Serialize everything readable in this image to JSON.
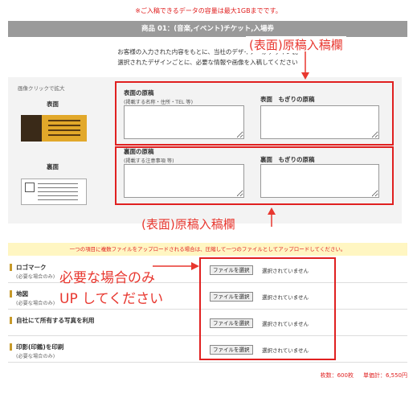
{
  "notice": "※ご入稿できるデータの容量は最大1GBまでです。",
  "product_title": "商品 01：(音楽,イベント)チケット,入場券",
  "intro": {
    "line1": "お客様の入力された内容をもとに、当社のデザイナーがデザイン制",
    "line2": "選択されたデザインごとに、必要な情報や画像を入稿してください"
  },
  "annotations": {
    "top": "(表面)原稿入稿欄",
    "bottom": "(表面)原稿入稿欄",
    "upload_note_line1": "必要な場合のみ",
    "upload_note_line2": "UP してください"
  },
  "preview": {
    "enlarge_hint": "画像クリックで拡大",
    "front_label": "表面",
    "back_label": "裏面"
  },
  "front_section": {
    "left_title": "表面の原稿",
    "left_sub": "(掲載する名称・住所・TEL 等)",
    "right_title": "表面　もぎりの原稿"
  },
  "back_section": {
    "left_title": "裏面の原稿",
    "left_sub": "(掲載する注意事項 等)",
    "right_title": "裏面　もぎりの原稿"
  },
  "warning": "一つの項目に複数ファイルをアップロードされる場合は、圧縮して一つのファイルとしてアップロードしてください。",
  "uploads": [
    {
      "label": "ロゴマーク",
      "hint": "(必要な場合のみ)",
      "button": "ファイルを選択",
      "status": "選択されていません"
    },
    {
      "label": "地図",
      "hint": "(必要な場合のみ)",
      "button": "ファイルを選択",
      "status": "選択されていません"
    },
    {
      "label": "自社にて所有する写真を利用",
      "hint": "",
      "button": "ファイルを選択",
      "status": "選択されていません"
    },
    {
      "label": "印影(印鑑)を印刷",
      "hint": "(必要な場合のみ)",
      "button": "ファイルを選択",
      "status": "選択されていません"
    }
  ],
  "summary": {
    "quantity": "枚数：600枚",
    "total": "単価計：6,550円"
  },
  "colors": {
    "accent_red": "#e02020",
    "title_bar": "#9a9a9a",
    "warning_bg": "#fff6c2"
  }
}
